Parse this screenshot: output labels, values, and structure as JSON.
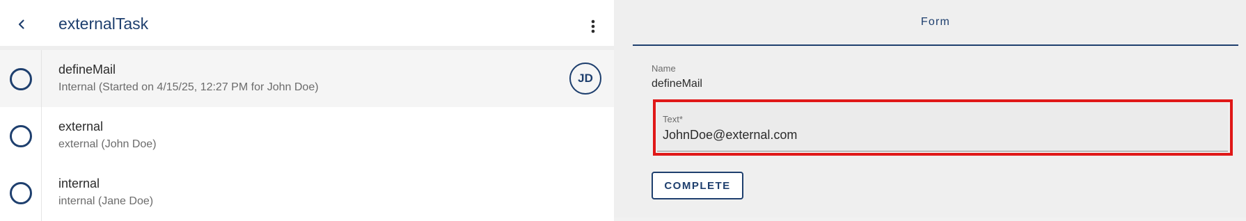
{
  "header": {
    "title": "externalTask",
    "back_icon": "chevron-left-icon",
    "menu_icon": "more-vertical-icon"
  },
  "tasks": [
    {
      "title": "defineMail",
      "subtitle": "Internal (Started on 4/15/25, 12:27 PM for John Doe)",
      "avatar": "JD",
      "selected": true
    },
    {
      "title": "external",
      "subtitle": "external (John Doe)"
    },
    {
      "title": "internal",
      "subtitle": "internal (Jane Doe)"
    }
  ],
  "form": {
    "tab_label": "Form",
    "name_label": "Name",
    "name_value": "defineMail",
    "text_label": "Text*",
    "text_value": "JohnDoe@external.com",
    "complete_label": "COMPLETE"
  },
  "colors": {
    "primary": "#1e3f6e",
    "highlight": "#e01818"
  }
}
